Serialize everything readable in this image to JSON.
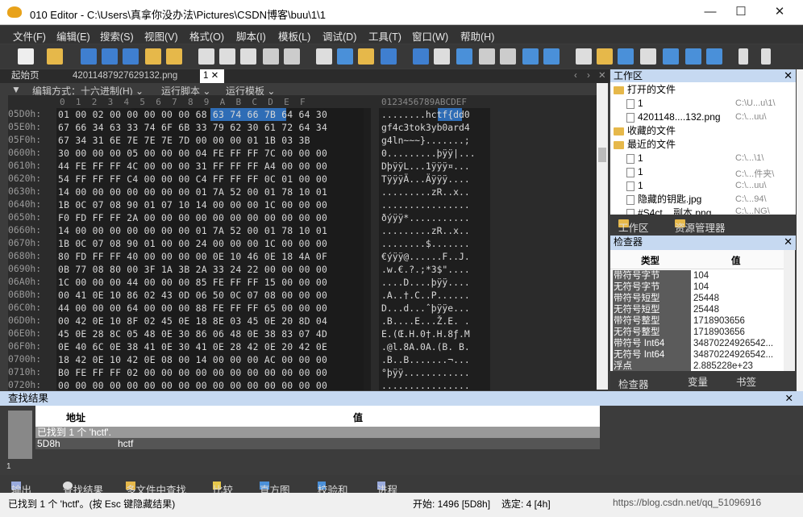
{
  "window": {
    "title": "010 Editor - C:\\Users\\真拿你没办法\\Pictures\\CSDN博客\\buu\\1\\1",
    "minimize": "—",
    "maximize": "☐",
    "close": "✕"
  },
  "menu": [
    "文件(F)",
    "编辑(E)",
    "搜索(S)",
    "视图(V)",
    "格式(O)",
    "脚本(I)",
    "模板(L)",
    "调试(D)",
    "工具(T)",
    "窗口(W)",
    "帮助(H)"
  ],
  "tabs": {
    "start": "起始页",
    "file1": "4201148792762​9132.png",
    "file2": "1",
    "file2_close": "✕",
    "nav_left": "‹",
    "nav_right": "›",
    "nav_close": "✕"
  },
  "subbar": {
    "arrow": "▼",
    "edit_mode": "编辑方式：十六进制(H) ⌄",
    "run_script": "运行脚本 ⌄",
    "run_template": "运行模板 ⌄"
  },
  "hex": {
    "col_hex": "0  1  2  3  4  5  6  7  8  9  A  B  C  D  E  F",
    "col_ascii": "0123456789ABCDEF",
    "rows": [
      {
        "addr": "05D0h:",
        "hex": "01 00 02 00 00 00 00 00 68 63 74 66 7B 64 64 30",
        "ascii": "........hctf{dd0"
      },
      {
        "addr": "05E0h:",
        "hex": "67 66 34 63 33 74 6F 6B 33 79 62 30 61 72 64 34",
        "ascii": "gf4c3tok3yb0ard4"
      },
      {
        "addr": "05F0h:",
        "hex": "67 34 31 6E 7E 7E 7E 7D 00 00 00 01 1B 03 3B",
        "ascii": "g4ln~~~}.......;"
      },
      {
        "addr": "0600h:",
        "hex": "30 00 00 00 05 00 00 00 04 FE FF FF 7C 00 00 00",
        "ascii": "0.........þÿÿ|..."
      },
      {
        "addr": "0610h:",
        "hex": "44 FE FF FF 4C 00 00 00 31 FF FF FF A4 00 00 00",
        "ascii": "DþÿÿL...1ÿÿÿ¤..."
      },
      {
        "addr": "0620h:",
        "hex": "54 FF FF FF C4 00 00 00 C4 FF FF FF 0C 01 00 00",
        "ascii": "TÿÿÿÄ...Äÿÿÿ...."
      },
      {
        "addr": "0630h:",
        "hex": "14 00 00 00 00 00 00 00 01 7A 52 00 01 78 10 01",
        "ascii": ".........zR..x.."
      },
      {
        "addr": "0640h:",
        "hex": "1B 0C 07 08 90 01 07 10 14 00 00 00 1C 00 00 00",
        "ascii": "................"
      },
      {
        "addr": "0650h:",
        "hex": "F0 FD FF FF 2A 00 00 00 00 00 00 00 00 00 00 00",
        "ascii": "ðýÿÿ*..........."
      },
      {
        "addr": "0660h:",
        "hex": "14 00 00 00 00 00 00 00 01 7A 52 00 01 78 10 01",
        "ascii": ".........zR..x.."
      },
      {
        "addr": "0670h:",
        "hex": "1B 0C 07 08 90 01 00 00 24 00 00 00 1C 00 00 00",
        "ascii": "........$......."
      },
      {
        "addr": "0680h:",
        "hex": "80 FD FF FF 40 00 00 00 00 0E 10 46 0E 18 4A 0F",
        "ascii": "€ýÿÿ@......F..J."
      },
      {
        "addr": "0690h:",
        "hex": "0B 77 08 80 00 3F 1A 3B 2A 33 24 22 00 00 00 00",
        "ascii": ".w.€.?.;*3$\"...."
      },
      {
        "addr": "06A0h:",
        "hex": "1C 00 00 00 44 00 00 00 85 FE FF FF 15 00 00 00",
        "ascii": "....D....þÿÿ...."
      },
      {
        "addr": "06B0h:",
        "hex": "00 41 0E 10 86 02 43 0D 06 50 0C 07 08 00 00 00",
        "ascii": ".A..†.C..P......"
      },
      {
        "addr": "06C0h:",
        "hex": "44 00 00 00 64 00 00 00 88 FE FF FF 65 00 00 00",
        "ascii": "D...d...ˆþÿÿe..."
      },
      {
        "addr": "06D0h:",
        "hex": "00 42 0E 10 8F 02 45 0E 18 8E 03 45 0E 20 8D 04",
        "ascii": ".B....E...Ž.E. ."
      },
      {
        "addr": "06E0h:",
        "hex": "45 0E 28 8C 05 48 0E 30 86 06 48 0E 38 83 07 4D",
        "ascii": "E.(Œ.H.0†.H.8ƒ.M"
      },
      {
        "addr": "06F0h:",
        "hex": "0E 40 6C 0E 38 41 0E 30 41 0E 28 42 0E 20 42 0E",
        "ascii": ".@l.8A.0A.(B. B."
      },
      {
        "addr": "0700h:",
        "hex": "18 42 0E 10 42 0E 08 00 14 00 00 00 AC 00 00 00",
        "ascii": ".B..B.......¬..."
      },
      {
        "addr": "0710h:",
        "hex": "B0 FE FF FF 02 00 00 00 00 00 00 00 00 00 00 00",
        "ascii": "°þÿÿ............"
      },
      {
        "addr": "0720h:",
        "hex": "00 00 00 00 00 00 00 00 00 00 00 00 00 00 00 00",
        "ascii": "................"
      }
    ]
  },
  "workspace": {
    "title": "工作区",
    "open_files": "打开的文件",
    "of1": "1",
    "of1_path": "C:\\U...u\\1\\",
    "of2": "4201148....132.png",
    "of2_path": "C:\\...uu\\",
    "favorites": "收藏的文件",
    "recent": "最近的文件",
    "r1": "1",
    "r1_path": "C:\\...\\1\\",
    "r2": "1",
    "r2_path": "C:\\...件夹\\",
    "r3": "1",
    "r3_path": "C:\\...uu\\",
    "r4": "隐藏的钥匙.jpg",
    "r4_path": "C:\\...94\\",
    "r5": "#S4ct... 副本.png",
    "r5_path": "C:\\...NG\\",
    "tab1": "工作区",
    "tab2": "资源管理器"
  },
  "inspector": {
    "title": "检查器",
    "col_type": "类型",
    "col_value": "值",
    "rows": [
      {
        "k": "带符号字节",
        "v": "104"
      },
      {
        "k": "无符号字节",
        "v": "104"
      },
      {
        "k": "带符号短型",
        "v": "25448"
      },
      {
        "k": "无符号短型",
        "v": "25448"
      },
      {
        "k": "带符号整型",
        "v": "1718903656"
      },
      {
        "k": "无符号整型",
        "v": "1718903656"
      },
      {
        "k": "带符号 Int64",
        "v": "34870224926542..."
      },
      {
        "k": "无符号 Int64",
        "v": "34870224926542..."
      },
      {
        "k": "浮点",
        "v": "2.885228e+23"
      }
    ],
    "tab1": "检查器",
    "tab2": "变量",
    "tab3": "书签"
  },
  "find": {
    "title": "查找结果",
    "col_addr": "地址",
    "col_value": "值",
    "summary": "已找到 1 个 'hctf'.",
    "res_addr": "5D8h",
    "res_value": "hctf",
    "small": "1"
  },
  "bottom_tabs": [
    "输出",
    "查找结果",
    "多文件中查找",
    "比较",
    "直方图",
    "校验和",
    "进程"
  ],
  "status": {
    "msg": "已找到 1 个 'hctf'。(按 Esc 键隐藏结果)",
    "start": "开始: 1496 [5D8h]",
    "sel": "选定: 4 [4h]",
    "watermark": "https://blog.csdn.net/qq_51096916"
  }
}
